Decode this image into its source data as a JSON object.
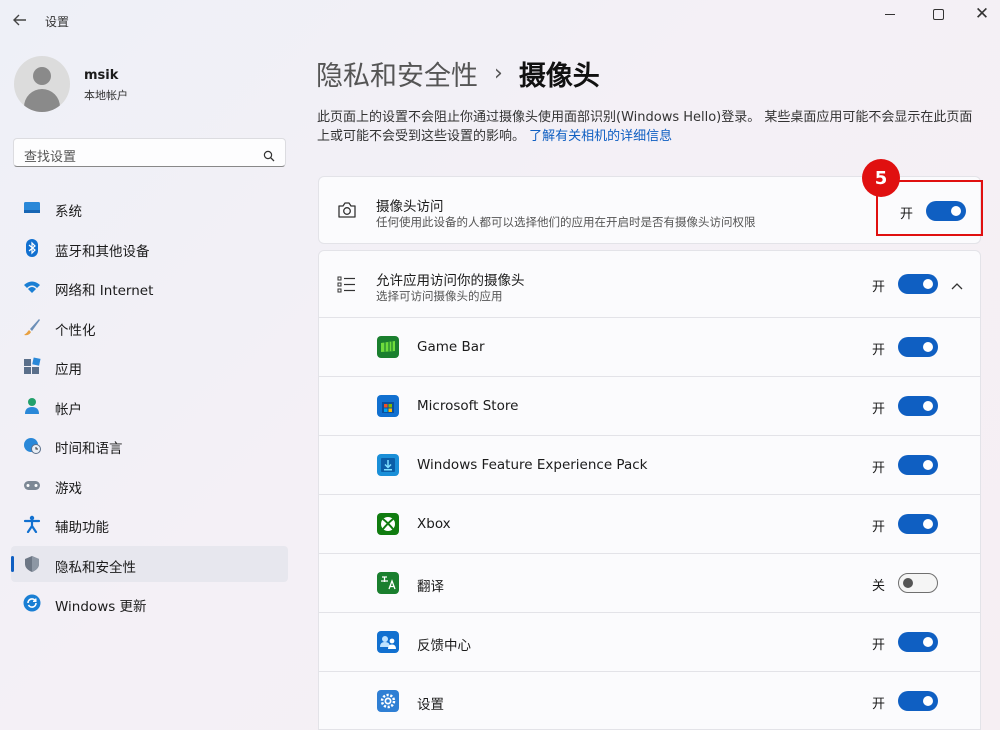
{
  "window": {
    "title": "设置"
  },
  "user": {
    "name": "msik",
    "account_type": "本地帐户"
  },
  "search": {
    "placeholder": "查找设置"
  },
  "nav": {
    "items": [
      {
        "label": "系统",
        "icon": "monitor-icon"
      },
      {
        "label": "蓝牙和其他设备",
        "icon": "bluetooth-icon"
      },
      {
        "label": "网络和 Internet",
        "icon": "wifi-icon"
      },
      {
        "label": "个性化",
        "icon": "brush-icon"
      },
      {
        "label": "应用",
        "icon": "apps-icon"
      },
      {
        "label": "帐户",
        "icon": "account-icon"
      },
      {
        "label": "时间和语言",
        "icon": "globe-clock-icon"
      },
      {
        "label": "游戏",
        "icon": "gamepad-icon"
      },
      {
        "label": "辅助功能",
        "icon": "accessibility-icon"
      },
      {
        "label": "隐私和安全性",
        "icon": "shield-icon",
        "active": true
      },
      {
        "label": "Windows 更新",
        "icon": "update-icon"
      }
    ]
  },
  "breadcrumb": {
    "parent": "隐私和安全性",
    "separator": "›",
    "current": "摄像头"
  },
  "description": {
    "text": "此页面上的设置不会阻止你通过摄像头使用面部识别(Windows Hello)登录。 某些桌面应用可能不会显示在此页面上或可能不会受到这些设置的影响。",
    "link": "了解有关相机的详细信息"
  },
  "camera_access": {
    "title": "摄像头访问",
    "subtitle": "任何使用此设备的人都可以选择他们的应用在开启时是否有摄像头访问权限",
    "state_label": "开",
    "on": true,
    "icon": "camera-icon"
  },
  "app_access": {
    "title": "允许应用访问你的摄像头",
    "subtitle": "选择可访问摄像头的应用",
    "state_label": "开",
    "on": true,
    "icon": "list-icon",
    "expanded": true
  },
  "apps": [
    {
      "name": "Game Bar",
      "state_label": "开",
      "on": true,
      "icon": "game-bar-icon",
      "color": "#1a7f2e"
    },
    {
      "name": "Microsoft Store",
      "state_label": "开",
      "on": true,
      "icon": "microsoft-store-icon",
      "color": "#1170d0"
    },
    {
      "name": "Windows Feature Experience Pack",
      "state_label": "开",
      "on": true,
      "icon": "feature-pack-icon",
      "color": "#1a8fd8"
    },
    {
      "name": "Xbox",
      "state_label": "开",
      "on": true,
      "icon": "xbox-icon",
      "color": "#107c10"
    },
    {
      "name": "翻译",
      "state_label": "关",
      "on": false,
      "icon": "translate-icon",
      "color": "#1a7f2e"
    },
    {
      "name": "反馈中心",
      "state_label": "开",
      "on": true,
      "icon": "feedback-hub-icon",
      "color": "#1170d0"
    },
    {
      "name": "设置",
      "state_label": "开",
      "on": true,
      "icon": "settings-app-icon",
      "color": "#2f7fd4"
    }
  ],
  "annotation": {
    "badge": "5"
  },
  "colors": {
    "accent": "#0f5fc2",
    "annotation": "#e01010"
  }
}
